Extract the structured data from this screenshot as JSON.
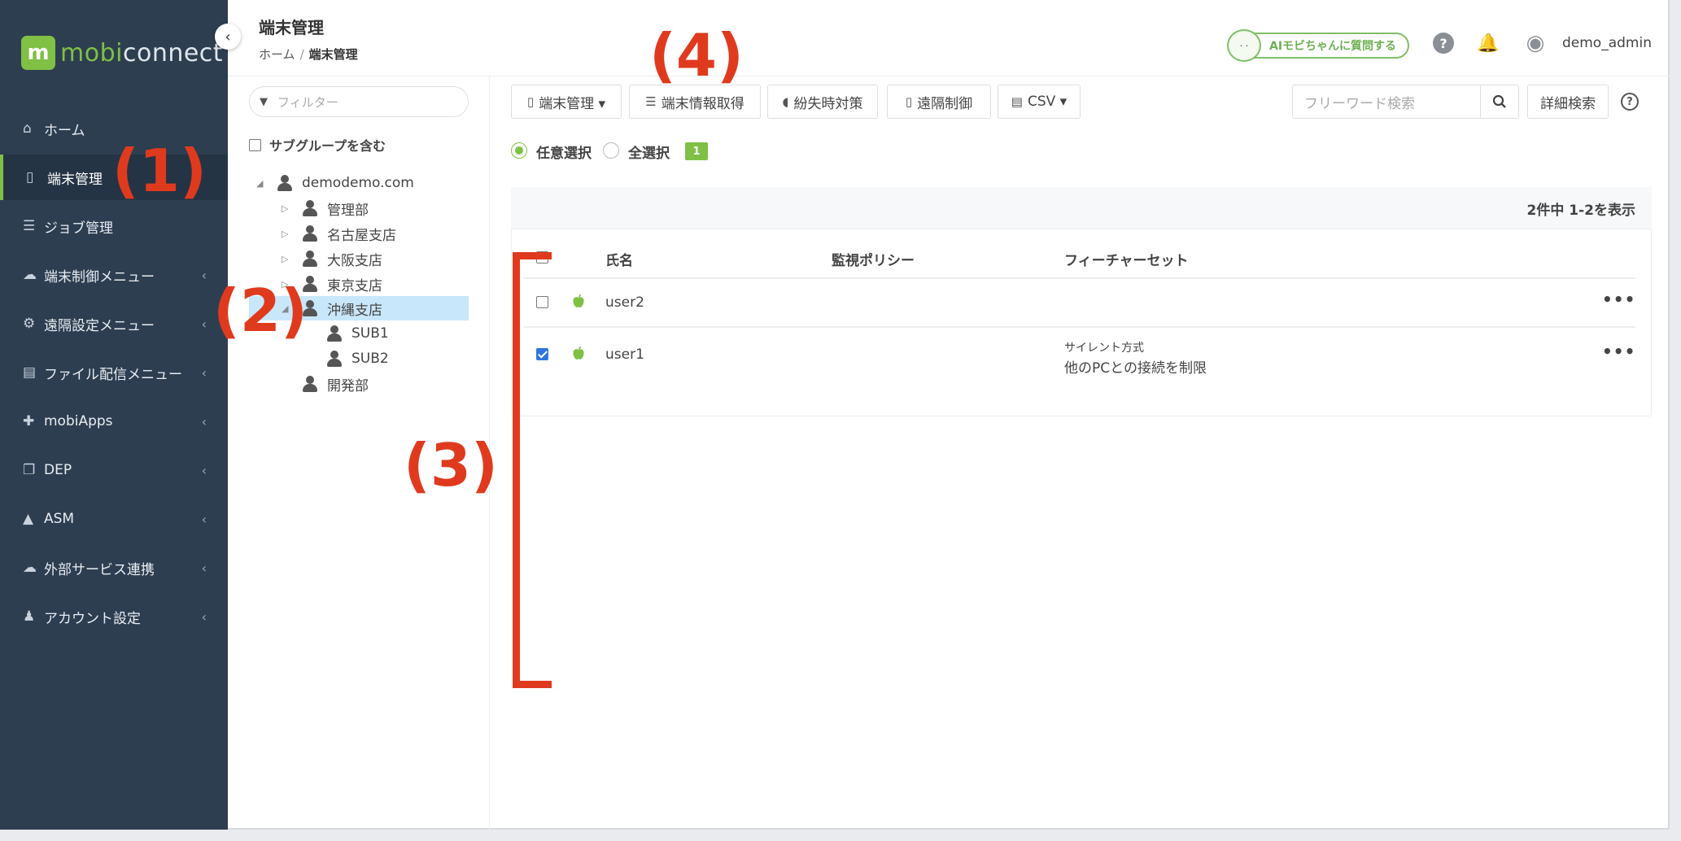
{
  "brand": {
    "mark": "m",
    "name_a": "mobi",
    "name_b": "connect"
  },
  "sidebar": {
    "items": [
      {
        "label": "ホーム",
        "icon": "home-icon"
      },
      {
        "label": "端末管理",
        "icon": "tablet-icon",
        "active": true
      },
      {
        "label": "ジョブ管理",
        "icon": "server-icon"
      },
      {
        "label": "端末制御メニュー",
        "icon": "cloud-signal-icon",
        "chevron": "‹"
      },
      {
        "label": "遠隔設定メニュー",
        "icon": "gears-icon",
        "chevron": "‹"
      },
      {
        "label": "ファイル配信メニュー",
        "icon": "file-icon",
        "chevron": "‹"
      },
      {
        "label": "mobiApps",
        "icon": "puzzle-icon",
        "chevron": "‹"
      },
      {
        "label": "DEP",
        "icon": "copy-icon",
        "chevron": "‹"
      },
      {
        "label": "ASM",
        "icon": "graduation-cap-icon",
        "chevron": "‹"
      },
      {
        "label": "外部サービス連携",
        "icon": "cloud-icon",
        "chevron": "‹"
      },
      {
        "label": "アカウント設定",
        "icon": "users-icon",
        "chevron": "‹"
      }
    ]
  },
  "header": {
    "title": "端末管理",
    "breadcrumb": {
      "home": "ホーム",
      "sep": "/",
      "current": "端末管理"
    },
    "ai_button": "AIモビちゃんに質問する",
    "ai_face": "·  ·",
    "help_icon": "?",
    "bell_icon": "🔔",
    "user_icon": "◉",
    "user": "demo_admin"
  },
  "tree": {
    "filter_placeholder": "フィルター",
    "include_subgroups": "サブグループを含む",
    "nodes": [
      {
        "label": "demodemo.com",
        "toggle": "◢"
      },
      {
        "label": "管理部",
        "toggle": "▷"
      },
      {
        "label": "名古屋支店",
        "toggle": "▷"
      },
      {
        "label": "大阪支店",
        "toggle": "▷"
      },
      {
        "label": "東京支店",
        "toggle": "▷"
      },
      {
        "label": "沖縄支店",
        "toggle": "◢",
        "selected": true
      },
      {
        "label": "SUB1",
        "toggle": ""
      },
      {
        "label": "SUB2",
        "toggle": ""
      },
      {
        "label": "開発部",
        "toggle": ""
      }
    ]
  },
  "toolbar": {
    "device_mgmt": "端末管理 ▾",
    "fetch_info": "端末情報取得",
    "loss_measures": "紛失時対策",
    "remote_control": "遠隔制御",
    "csv": "CSV ▾",
    "search_placeholder": "フリーワード検索",
    "advanced_search": "詳細検索",
    "help": "?"
  },
  "selection": {
    "arbitrary": "任意選択",
    "all": "全選択",
    "count": "1",
    "mode": "arbitrary"
  },
  "table": {
    "count_text": "2件中 1-2を表示",
    "columns": [
      "氏名",
      "監視ポリシー",
      "フィーチャーセット"
    ],
    "rows": [
      {
        "name": "user2",
        "policy": "",
        "feature_title": "",
        "feature_detail": "",
        "checked": false,
        "more": "•••"
      },
      {
        "name": "user1",
        "policy": "",
        "feature_title": "サイレント方式",
        "feature_detail": "他のPCとの接続を制限",
        "checked": true,
        "more": "•••"
      }
    ]
  },
  "annotations": {
    "a1": "(1)",
    "a2": "(2)",
    "a3": "(3)",
    "a4": "(4)",
    "color": "#e03a1e"
  },
  "colors": {
    "sidebar_bg": "#2d3e50",
    "accent_green": "#7fc045",
    "selected_node": "#c9e7fb",
    "annotation": "#e03a1e"
  }
}
